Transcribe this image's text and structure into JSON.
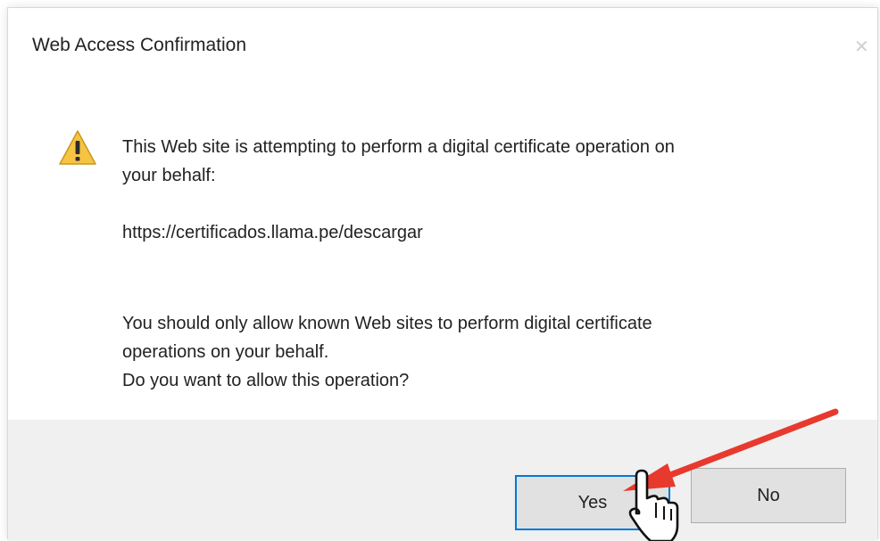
{
  "dialog": {
    "title": "Web Access Confirmation",
    "close_icon": "close-icon",
    "warning_icon": "warning-icon",
    "message_line1": "This Web site is attempting to perform a digital certificate operation on",
    "message_line2": "your behalf:",
    "url": "https://certificados.llama.pe/descargar",
    "advice_line1": "You should only allow known Web sites to perform digital certificate",
    "advice_line2": "operations on your behalf.",
    "question": "Do you want to allow this operation?"
  },
  "buttons": {
    "yes_label": "Yes",
    "no_label": "No"
  },
  "colors": {
    "focus_border": "#0078d7",
    "annotation_arrow": "#e8392e",
    "warning_fill": "#f6c342"
  },
  "annotations": {
    "arrow_icon": "red-arrow-icon",
    "cursor_icon": "hand-cursor-icon"
  }
}
